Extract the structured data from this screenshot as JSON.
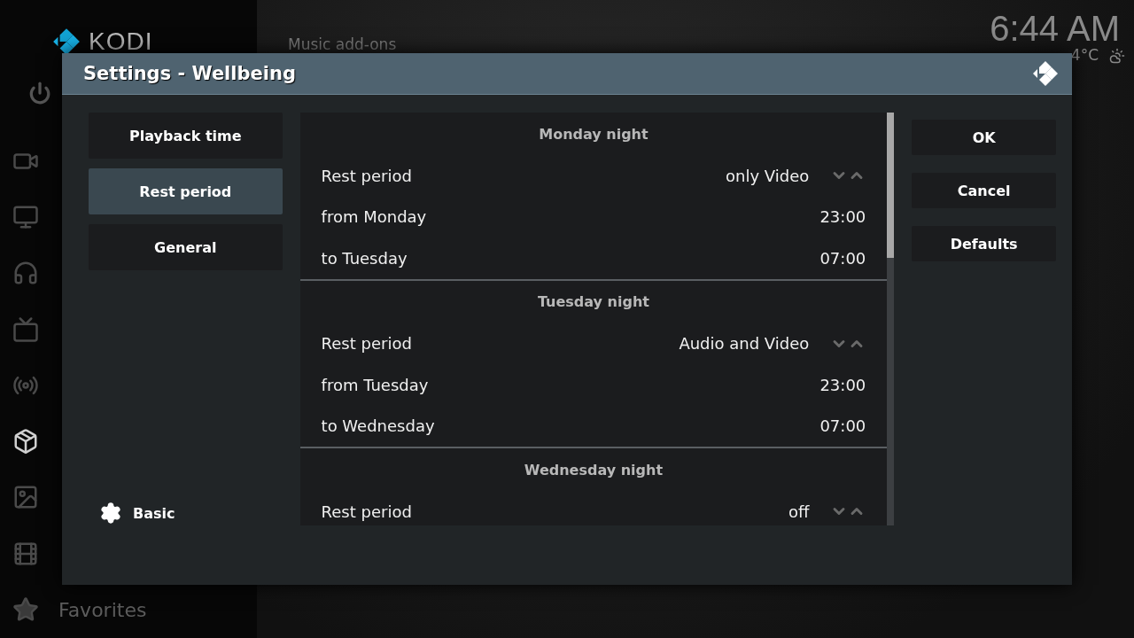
{
  "home": {
    "logo": "KODI",
    "clock": "6:44 AM",
    "weather": "4°C",
    "section_title": "Music add-ons",
    "sidebar": [
      {
        "selected": false
      },
      {
        "selected": false
      },
      {
        "selected": false
      },
      {
        "selected": false
      },
      {
        "selected": false
      },
      {
        "selected": true
      },
      {
        "selected": false
      },
      {
        "selected": false
      },
      {
        "selected": false,
        "label": "Favorites"
      }
    ]
  },
  "dialog": {
    "title": "Settings - Wellbeing",
    "categories": [
      {
        "label": "Playback time",
        "selected": false
      },
      {
        "label": "Rest period",
        "selected": true
      },
      {
        "label": "General",
        "selected": false
      }
    ],
    "level": "Basic",
    "sections": [
      {
        "title": "Monday night",
        "rows": [
          {
            "kind": "spinner",
            "label": "Rest period",
            "value": "only Video"
          },
          {
            "kind": "value",
            "label": "from Monday",
            "value": "23:00"
          },
          {
            "kind": "value",
            "label": "to Tuesday",
            "value": "07:00"
          }
        ]
      },
      {
        "title": "Tuesday night",
        "rows": [
          {
            "kind": "spinner",
            "label": "Rest period",
            "value": "Audio and Video"
          },
          {
            "kind": "value",
            "label": "from Tuesday",
            "value": "23:00"
          },
          {
            "kind": "value",
            "label": "to Wednesday",
            "value": "07:00"
          }
        ]
      },
      {
        "title": "Wednesday night",
        "rows": [
          {
            "kind": "spinner",
            "label": "Rest period",
            "value": "off"
          }
        ]
      }
    ],
    "buttons": [
      "OK",
      "Cancel",
      "Defaults"
    ]
  }
}
